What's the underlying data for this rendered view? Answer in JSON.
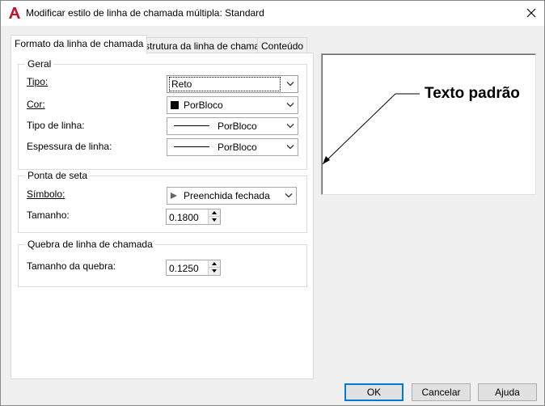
{
  "window": {
    "title": "Modificar estilo de linha de chamada múltipla: Standard"
  },
  "tabs": [
    {
      "label": "Formato da linha de chamada",
      "active": true
    },
    {
      "label": "Estrutura da linha de chamada",
      "active": false
    },
    {
      "label": "Conteúdo",
      "active": false
    }
  ],
  "geral": {
    "title": "Geral",
    "tipo_label": "Tipo:",
    "tipo_value": "Reto",
    "cor_label": "Cor:",
    "cor_value": "PorBloco",
    "tipo_linha_label": "Tipo de linha:",
    "tipo_linha_value": "PorBloco",
    "espessura_label": "Espessura de linha:",
    "espessura_value": "PorBloco"
  },
  "ponta_seta": {
    "title": "Ponta de seta",
    "simbolo_label": "Símbolo:",
    "simbolo_value": "Preenchida fechada",
    "tamanho_label": "Tamanho:",
    "tamanho_value": "0.1800"
  },
  "quebra": {
    "title": "Quebra de linha de chamada",
    "tamanho_label": "Tamanho da quebra:",
    "tamanho_value": "0.1250"
  },
  "preview": {
    "text": "Texto padrão"
  },
  "buttons": {
    "ok": "OK",
    "cancel": "Cancelar",
    "help": "Ajuda"
  },
  "colors": {
    "app_icon": "#c8102e",
    "default_button_border": "#0078d7",
    "cor_swatch": "#000000"
  },
  "icons": {
    "app": "autocad-a-icon",
    "close": "close-icon",
    "dropdown": "chevron-down-icon",
    "spin_up": "spin-up-icon",
    "spin_down": "spin-down-icon"
  }
}
